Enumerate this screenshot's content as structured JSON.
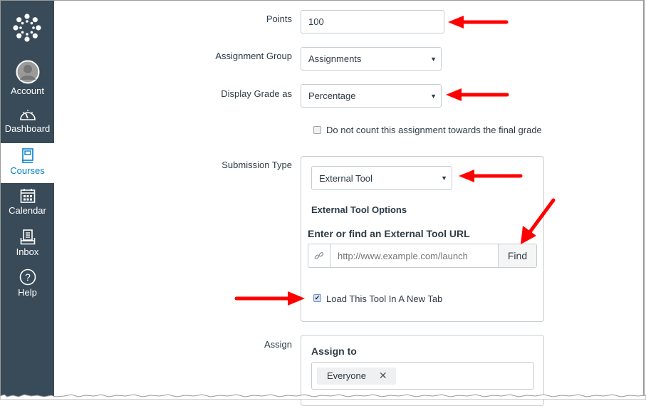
{
  "sidebar": {
    "items": [
      {
        "label": "Account",
        "icon": "account-avatar-icon",
        "active": false
      },
      {
        "label": "Dashboard",
        "icon": "dashboard-speedometer-icon",
        "active": false
      },
      {
        "label": "Courses",
        "icon": "courses-book-icon",
        "active": true
      },
      {
        "label": "Calendar",
        "icon": "calendar-icon",
        "active": false
      },
      {
        "label": "Inbox",
        "icon": "inbox-icon",
        "active": false
      },
      {
        "label": "Help",
        "icon": "help-question-icon",
        "active": false
      }
    ],
    "logo": "canvas-logo-icon",
    "colors": {
      "background": "#394b58",
      "active_text": "#0081c1"
    }
  },
  "form": {
    "points": {
      "label": "Points",
      "value": "100"
    },
    "assignment_group": {
      "label": "Assignment Group",
      "selected": "Assignments"
    },
    "display_grade": {
      "label": "Display Grade as",
      "selected": "Percentage"
    },
    "exclude_final": {
      "label": "Do not count this assignment towards the final grade",
      "checked": false
    },
    "submission_type": {
      "label": "Submission Type",
      "selected": "External Tool",
      "options_heading": "External Tool Options",
      "url_heading": "Enter or find an External Tool URL",
      "url_placeholder": "http://www.example.com/launch",
      "url_value": "",
      "find_button": "Find",
      "new_tab": {
        "label": "Load This Tool In A New Tab",
        "checked": true
      }
    },
    "assign": {
      "label": "Assign",
      "heading": "Assign to",
      "tokens": [
        {
          "label": "Everyone"
        }
      ]
    }
  },
  "annotations": {
    "arrow_color": "#ff0000"
  }
}
